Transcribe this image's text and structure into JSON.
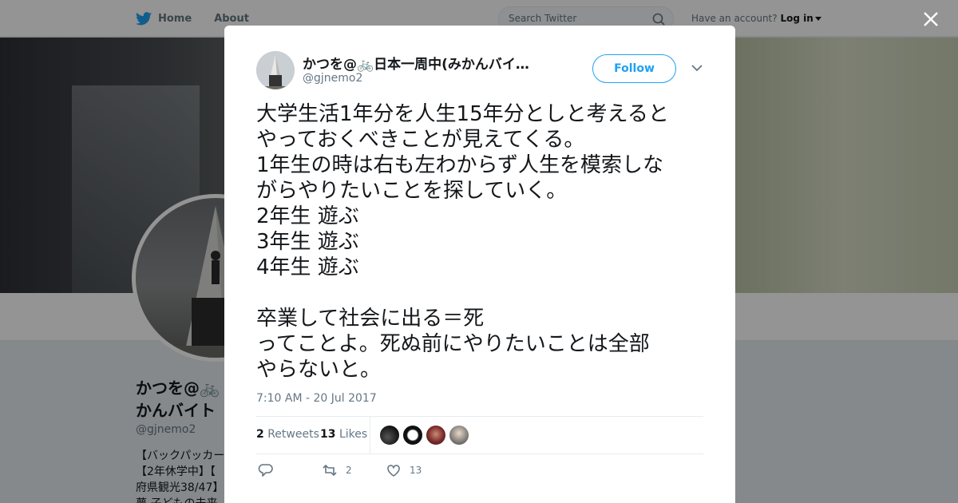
{
  "nav": {
    "home_label": "Home",
    "about_label": "About",
    "search_placeholder": "Search Twitter",
    "account_prompt": "Have an account?",
    "login_label": "Log in"
  },
  "profile": {
    "name_line1": "かつを@🚲",
    "name_line2": "かんバイト",
    "handle": "@gjnemo2",
    "bio_lines": [
      "【バックパッカー",
      "【2年休学中】【",
      "府県観光38/47】",
      "夢 子どもの未来"
    ]
  },
  "tweet": {
    "author_name": "かつを@🚲日本一周中(みかんバイ…",
    "author_handle": "@gjnemo2",
    "follow_label": "Follow",
    "text": "大学生活1年分を人生15年分としと考えると\nやっておくべきことが見えてくる。\n1年生の時は右も左わからず人生を模索しな\nがらやりたいことを探していく。\n2年生 遊ぶ\n3年生 遊ぶ\n4年生 遊ぶ\n\n卒業して社会に出る＝死\nってことよ。死ぬ前にやりたいことは全部\nやらないと。",
    "timestamp": "7:10 AM - 20 Jul 2017",
    "retweets_count": "2",
    "retweets_label": "Retweets",
    "likes_count": "13",
    "likes_label": "Likes",
    "action_retweet_count": "2",
    "action_like_count": "13"
  },
  "icons": {
    "bird": "twitter-bird-icon",
    "search": "search-icon",
    "close": "close-icon",
    "chevron": "chevron-down-icon",
    "reply": "reply-icon",
    "retweet": "retweet-icon",
    "like": "heart-icon"
  },
  "colors": {
    "accent": "#1da1f2",
    "overlay": "#000000"
  }
}
